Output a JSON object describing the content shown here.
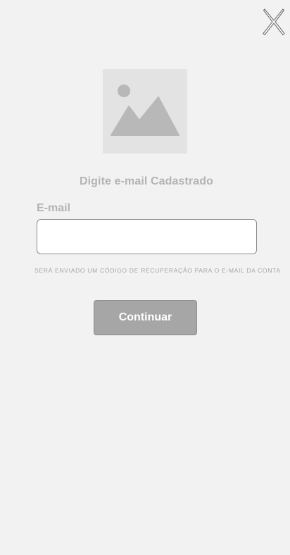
{
  "header": {
    "close_icon": "close-icon"
  },
  "media": {
    "placeholder_icon": "image-placeholder-icon"
  },
  "form": {
    "heading": "Digite e-mail Cadastrado",
    "email_label": "E-mail",
    "email_value": "",
    "email_placeholder": "",
    "helper_text": "SERÁ ENVIADO UM CÓDIGO DE RECUPERAÇÃO PARA  O E-MAIL DA CONTA",
    "continue_label": "Continuar"
  },
  "colors": {
    "background": "#f2f2f2",
    "placeholder_bg": "#e3e3e3",
    "placeholder_fg": "#b8b8b8",
    "label_text": "#b4b4b4",
    "button_bg": "#a6a6a6",
    "button_text": "#ffffff"
  }
}
